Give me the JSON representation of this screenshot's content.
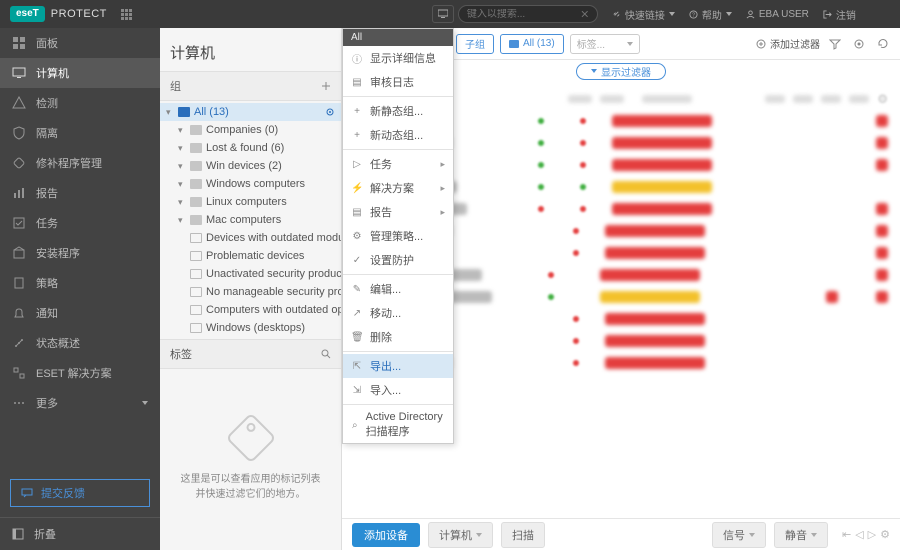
{
  "brand": {
    "logo": "eseT",
    "name": "PROTECT"
  },
  "topbar": {
    "search_placeholder": "键入以搜索...",
    "quick": "快速链接",
    "help": "帮助",
    "user": "EBA USER",
    "logout": "注销"
  },
  "sidebar": {
    "items": [
      "面板",
      "计算机",
      "检测",
      "隔离",
      "修补程序管理",
      "报告",
      "任务",
      "安装程序",
      "策略",
      "通知",
      "状态概述",
      "ESET 解决方案",
      "更多"
    ],
    "submit": "提交反馈",
    "collapse": "折叠"
  },
  "midpanel": {
    "title": "计算机",
    "groups_label": "组",
    "tree": {
      "root": "All (13)",
      "children": [
        "Companies (0)",
        "Lost & found (6)",
        "Win devices (2)",
        "Windows computers",
        "Linux computers",
        "Mac computers"
      ],
      "dynamic": [
        "Devices with outdated modules",
        "Problematic devices",
        "Unactivated security product",
        "No manageable security product",
        "Computers with outdated operating s...",
        "Windows (desktops)"
      ]
    },
    "tags_label": "标签",
    "tags_empty": "这里是可以查看应用的标记列表并快速过滤它们的地方。"
  },
  "toolbar": {
    "subgroup": "子组",
    "all_chip": "All (13)",
    "tags_placeholder": "标签...",
    "add_filter": "添加过滤器",
    "show_filter": "显示过滤器"
  },
  "context_menu": {
    "head": "All",
    "items1": [
      "显示详细信息",
      "审核日志"
    ],
    "items2": [
      "新静态组...",
      "新动态组..."
    ],
    "items3": [
      "任务",
      "解决方案",
      "报告",
      "管理策略...",
      "设置防护"
    ],
    "items4": [
      "编辑...",
      "移动...",
      "删除"
    ],
    "export": "导出...",
    "import": "导入...",
    "ad": "Active Directory 扫描程序"
  },
  "bottom": {
    "add": "添加设备",
    "computers": "计算机",
    "scan": "扫描",
    "mute": "静音",
    "signal": "信号"
  }
}
